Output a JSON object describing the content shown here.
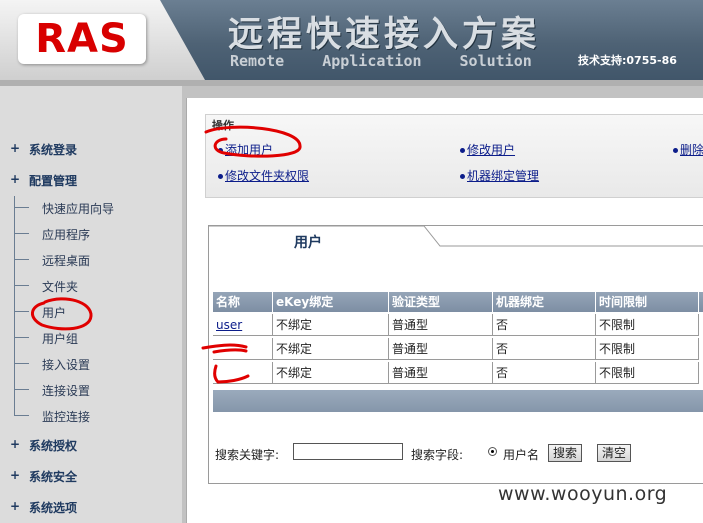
{
  "header": {
    "logo": "RAS",
    "title": "远程快速接入方案",
    "subtitle_words": [
      "Remote",
      "Application",
      "Solution"
    ],
    "support": "技术支持:0755-86"
  },
  "sidebar": {
    "top_items": [
      {
        "label": "系统登录"
      },
      {
        "label": "配置管理"
      },
      {
        "label": "系统授权"
      },
      {
        "label": "系统安全"
      },
      {
        "label": "系统选项"
      }
    ],
    "sub_items": [
      {
        "label": "快速应用向导"
      },
      {
        "label": "应用程序"
      },
      {
        "label": "远程桌面"
      },
      {
        "label": "文件夹"
      },
      {
        "label": "用户"
      },
      {
        "label": "用户组"
      },
      {
        "label": "接入设置"
      },
      {
        "label": "连接设置"
      },
      {
        "label": "监控连接"
      }
    ]
  },
  "operations": {
    "label": "操作",
    "links": [
      {
        "label": "添加用户"
      },
      {
        "label": "修改用户"
      },
      {
        "label": "删除"
      },
      {
        "label": "修改文件夹权限"
      },
      {
        "label": "机器绑定管理"
      }
    ]
  },
  "panel": {
    "tab_title": "用户",
    "columns": [
      "名称",
      "eKey绑定",
      "验证类型",
      "机器绑定",
      "时间限制"
    ],
    "rows": [
      {
        "name": "user",
        "ekey": "不绑定",
        "auth": "普通型",
        "machine": "否",
        "time": "不限制"
      },
      {
        "name": "",
        "ekey": "不绑定",
        "auth": "普通型",
        "machine": "否",
        "time": "不限制"
      },
      {
        "name": "",
        "ekey": "不绑定",
        "auth": "普通型",
        "machine": "否",
        "time": "不限制"
      }
    ]
  },
  "search": {
    "keyword_label": "搜索关键字:",
    "keyword_value": "",
    "field_label": "搜索字段:",
    "radio_label": "用户名",
    "search_button": "搜索",
    "clear_button": "清空"
  },
  "watermark": "www.wooyun.org",
  "colors": {
    "logo_red": "#d80000",
    "link_blue": "#0c1d8a",
    "annotation_red": "#e00000",
    "header": "#4e6275"
  }
}
